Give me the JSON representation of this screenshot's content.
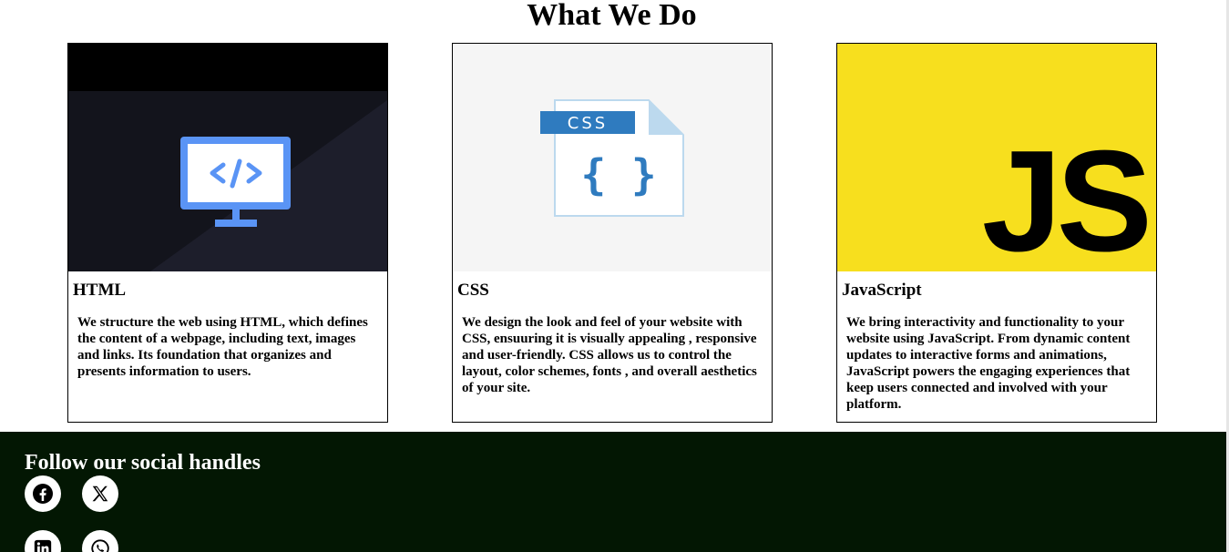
{
  "page": {
    "title": "What We Do"
  },
  "cards": [
    {
      "title": "HTML",
      "icon": "monitor-code-icon",
      "description": "We structure the web using HTML, which defines the content of a webpage, including text, images and links. Its foundation that organizes and presents information to users."
    },
    {
      "title": "CSS",
      "icon": "css-file-icon",
      "badge": "CSS",
      "description": "We design the look and feel of your website with CSS, ensuuring it is visually appealing , responsive and user-friendly. CSS allows us to control the layout, color schemes, fonts , and overall aesthetics of your site."
    },
    {
      "title": "JavaScript",
      "icon": "js-logo-icon",
      "logo_text": "JS",
      "description": "We bring interactivity and functionality to your website using JavaScript. From dynamic content updates to interactive forms and animations, JavaScript powers the engaging experiences that keep users connected and involved with your platform."
    }
  ],
  "footer": {
    "heading": "Follow our social handles",
    "social": [
      {
        "icon": "facebook-icon"
      },
      {
        "icon": "x-twitter-icon"
      },
      {
        "icon": "linkedin-icon"
      },
      {
        "icon": "whatsapp-icon"
      }
    ]
  },
  "colors": {
    "footer_bg": "#031703",
    "html_icon": "#4f8ef7",
    "css_blue": "#2f7bbf",
    "js_yellow": "#f7df1e"
  }
}
